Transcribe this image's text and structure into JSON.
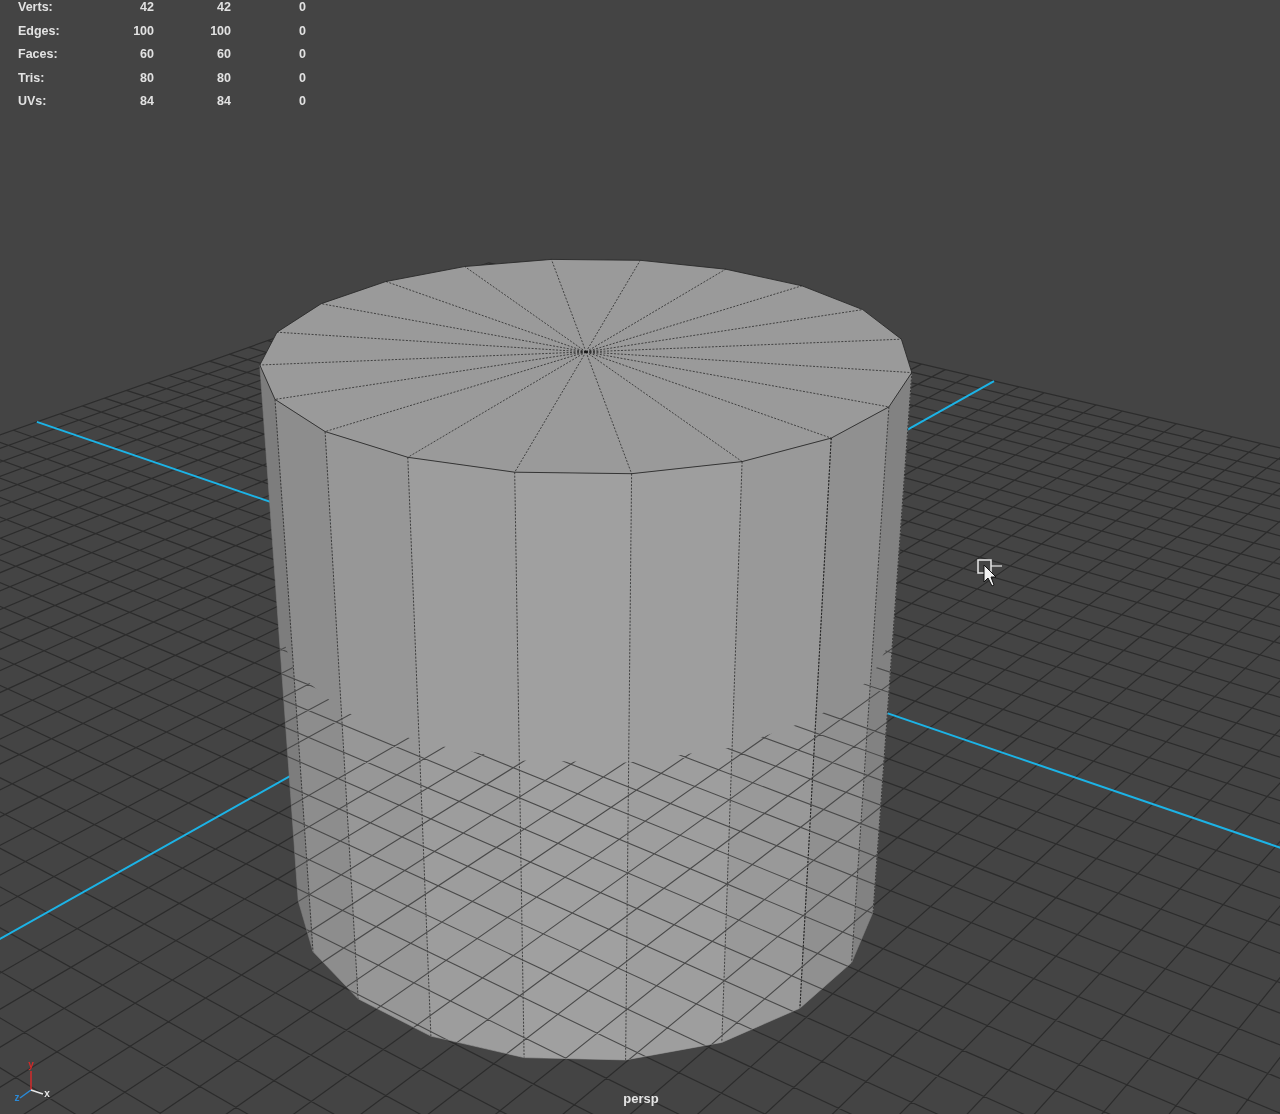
{
  "hud": {
    "rows": [
      {
        "label": "Verts:",
        "values": [
          "42",
          "42",
          "0"
        ]
      },
      {
        "label": "Edges:",
        "values": [
          "100",
          "100",
          "0"
        ]
      },
      {
        "label": "Faces:",
        "values": [
          "60",
          "60",
          "0"
        ]
      },
      {
        "label": "Tris:",
        "values": [
          "80",
          "80",
          "0"
        ]
      },
      {
        "label": "UVs:",
        "values": [
          "84",
          "84",
          "0"
        ]
      }
    ]
  },
  "axis_gizmo": [
    {
      "label": "y",
      "color": "#d42a2a"
    },
    {
      "label": "z",
      "color": "#2a8ad8"
    },
    {
      "label": "x",
      "color": "#e6e6e6"
    }
  ],
  "camera_label": "persp"
}
